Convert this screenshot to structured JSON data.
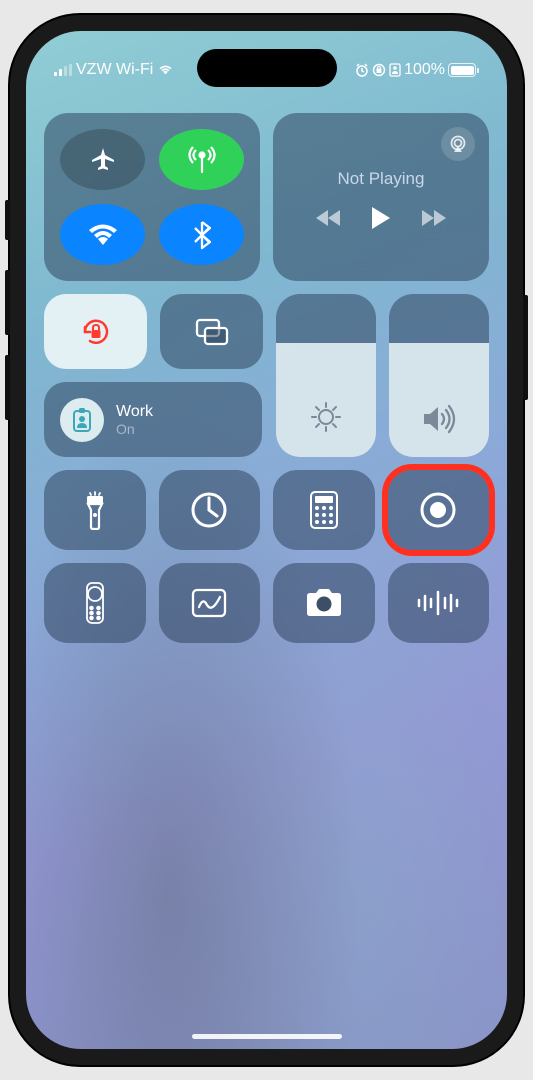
{
  "status": {
    "carrier": "VZW Wi-Fi",
    "battery": "100%",
    "alarm_icon": "alarm-icon",
    "orientation_icon": "orientation-icon",
    "contact_icon": "contact-icon"
  },
  "connectivity": {
    "airplane": {
      "name": "airplane-mode",
      "active": false
    },
    "cellular": {
      "name": "cellular-data",
      "active": true
    },
    "wifi": {
      "name": "wifi",
      "active": true
    },
    "bluetooth": {
      "name": "bluetooth",
      "active": true
    }
  },
  "media": {
    "title": "Not Playing",
    "airplay": "airplay-icon"
  },
  "orientation_lock": {
    "active": true
  },
  "screen_mirroring": {
    "name": "screen-mirroring"
  },
  "focus": {
    "label": "Work",
    "status": "On",
    "icon": "badge-icon"
  },
  "brightness": {
    "level": 70
  },
  "volume": {
    "level": 70
  },
  "tiles": {
    "row1": [
      {
        "name": "flashlight"
      },
      {
        "name": "timer"
      },
      {
        "name": "calculator"
      },
      {
        "name": "screen-record",
        "highlighted": true
      }
    ],
    "row2": [
      {
        "name": "apple-tv-remote"
      },
      {
        "name": "freeform"
      },
      {
        "name": "camera"
      },
      {
        "name": "voice-memos"
      }
    ]
  }
}
